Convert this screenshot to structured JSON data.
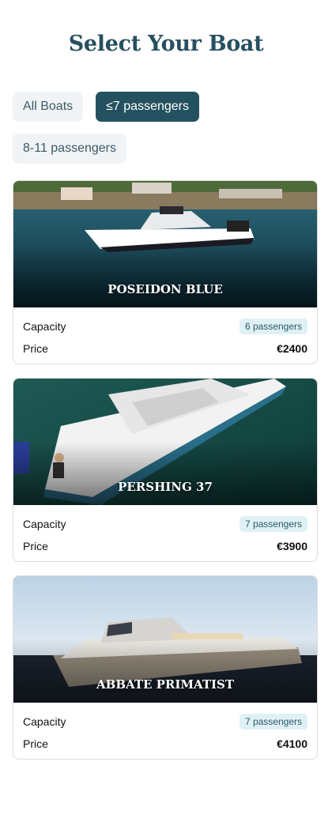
{
  "page": {
    "title": "Select Your Boat"
  },
  "filters": [
    {
      "label": "All Boats",
      "active": false
    },
    {
      "label": "≤7 passengers",
      "active": true
    },
    {
      "label": "8-11 passengers",
      "active": false
    }
  ],
  "labels": {
    "capacity": "Capacity",
    "price": "Price"
  },
  "boats": [
    {
      "name": "POSEIDON BLUE",
      "capacity": "6 passengers",
      "price": "€2400"
    },
    {
      "name": "PERSHING 37",
      "capacity": "7 passengers",
      "price": "€3900"
    },
    {
      "name": "ABBATE PRIMATIST",
      "capacity": "7 passengers",
      "price": "€4100"
    }
  ]
}
